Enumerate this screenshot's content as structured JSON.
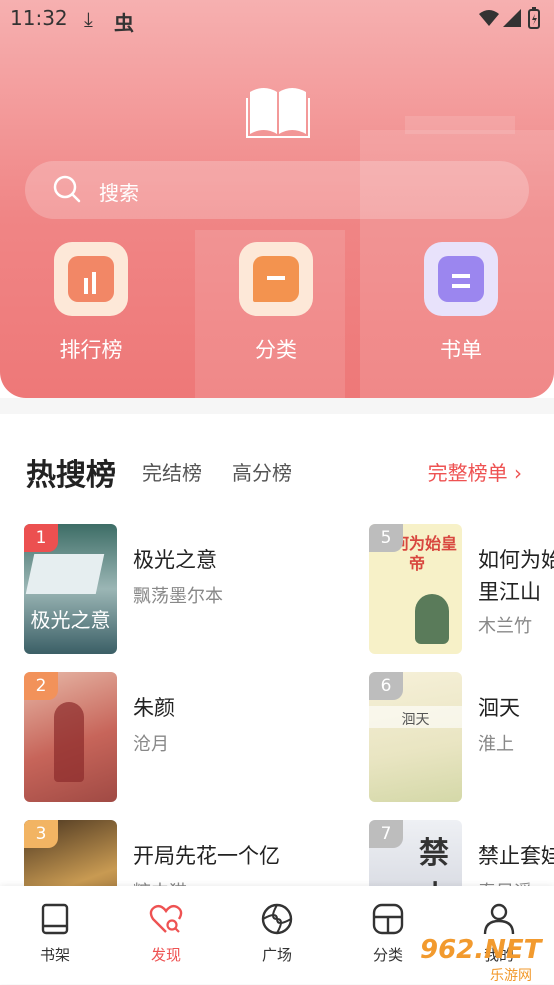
{
  "status_bar": {
    "time": "11:32"
  },
  "search": {
    "placeholder": "搜索"
  },
  "quick_entries": [
    {
      "label": "排行榜",
      "icon": "ranking-icon"
    },
    {
      "label": "分类",
      "icon": "category-icon"
    },
    {
      "label": "书单",
      "icon": "booklist-icon"
    }
  ],
  "ranking_tabs": {
    "active": "热搜榜",
    "tab2": "完结榜",
    "tab3": "高分榜",
    "more": "完整榜单 ›"
  },
  "books": [
    {
      "rank": "1",
      "title": "极光之意",
      "author": "飘荡墨尔本",
      "cover_text": "极光之意"
    },
    {
      "rank": "2",
      "title": "朱颜",
      "author": "沧月"
    },
    {
      "rank": "3",
      "title": "开局先花一个亿",
      "author": "糖中猫"
    },
    {
      "rank": "5",
      "title": "如何为始",
      "title2": "里江山",
      "author": "木兰竹",
      "cover_text": "如何为始皇帝"
    },
    {
      "rank": "6",
      "title": "洄天",
      "author": "淮上",
      "cover_text": "洄天"
    },
    {
      "rank": "7",
      "title": "禁止套娃",
      "author": "春风遥",
      "cover_text": "禁止"
    }
  ],
  "bottom_nav": [
    {
      "label": "书架",
      "icon": "bookshelf-icon"
    },
    {
      "label": "发现",
      "icon": "discover-icon",
      "active": true
    },
    {
      "label": "广场",
      "icon": "plaza-icon"
    },
    {
      "label": "分类",
      "icon": "category-icon"
    },
    {
      "label": "我的",
      "icon": "profile-icon"
    }
  ],
  "watermark": {
    "text": "962.NET",
    "sub": "乐游网"
  },
  "colors": {
    "accent": "#ee5252",
    "header": "#f08585"
  }
}
